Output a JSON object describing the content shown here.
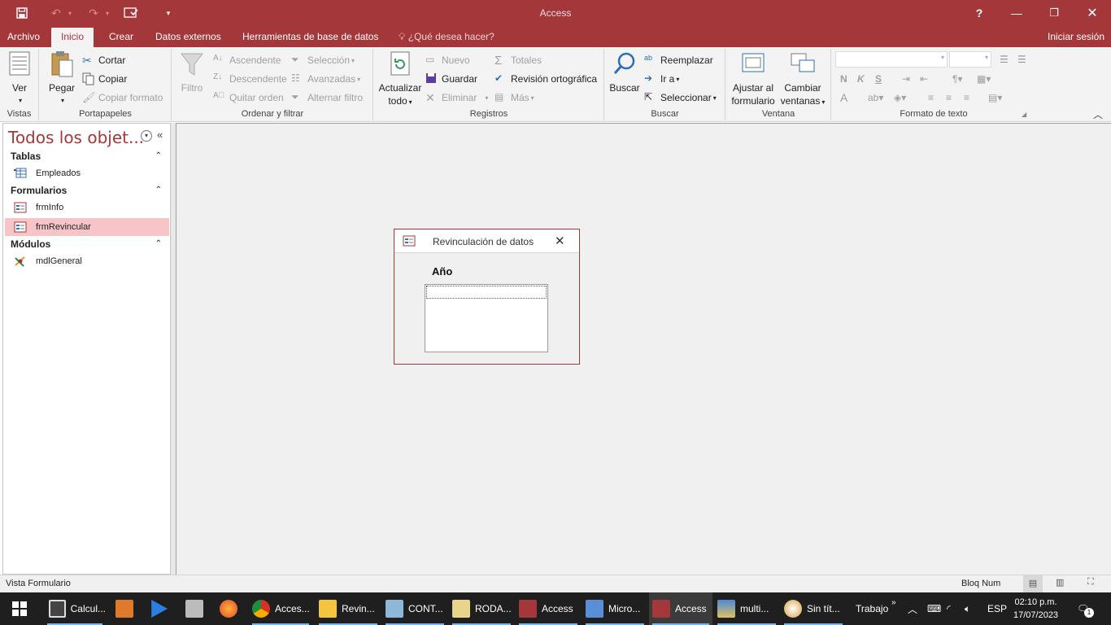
{
  "app": {
    "title": "Access",
    "help": "?",
    "signin": "Iniciar sesión"
  },
  "qat": {
    "save": "save-icon",
    "undo": "undo-icon",
    "redo": "redo-icon",
    "custom": "form-view-icon",
    "more": "▾"
  },
  "window": {
    "minimize": "—",
    "restore": "❐",
    "close": "✕"
  },
  "tabs": [
    {
      "label": "Archivo"
    },
    {
      "label": "Inicio"
    },
    {
      "label": "Crear"
    },
    {
      "label": "Datos externos"
    },
    {
      "label": "Herramientas de base de datos"
    }
  ],
  "tellme": "¿Qué desea hacer?",
  "ribbon": {
    "vistas": {
      "label": "Vistas",
      "ver": "Ver"
    },
    "portapapeles": {
      "label": "Portapapeles",
      "pegar": "Pegar",
      "cortar": "Cortar",
      "copiar": "Copiar",
      "copiar_formato": "Copiar formato"
    },
    "ordenar": {
      "label": "Ordenar y filtrar",
      "filtro": "Filtro",
      "ascendente": "Ascendente",
      "descendente": "Descendente",
      "quitar_orden": "Quitar orden",
      "seleccion": "Selección",
      "avanzadas": "Avanzadas",
      "alternar_filtro": "Alternar filtro"
    },
    "registros": {
      "label": "Registros",
      "actualizar": "Actualizar",
      "todo": "todo",
      "nuevo": "Nuevo",
      "guardar": "Guardar",
      "eliminar": "Eliminar",
      "totales": "Totales",
      "revision": "Revisión ortográfica",
      "mas": "Más"
    },
    "buscar": {
      "label": "Buscar",
      "buscar": "Buscar",
      "reemplazar": "Reemplazar",
      "ir_a": "Ir a",
      "seleccionar": "Seleccionar"
    },
    "ventana": {
      "label": "Ventana",
      "ajustar1": "Ajustar al",
      "ajustar2": "formulario",
      "cambiar1": "Cambiar",
      "cambiar2": "ventanas"
    },
    "formato": {
      "label": "Formato de texto",
      "bold": "N",
      "italic": "K",
      "underline": "S",
      "font_color": "A"
    }
  },
  "nav": {
    "title": "Todos los objet...",
    "sections": [
      {
        "label": "Tablas",
        "items": [
          {
            "label": "Empleados"
          }
        ]
      },
      {
        "label": "Formularios",
        "items": [
          {
            "label": "frmInfo"
          },
          {
            "label": "frmRevincular"
          }
        ]
      },
      {
        "label": "Módulos",
        "items": [
          {
            "label": "mdlGeneral"
          }
        ]
      }
    ]
  },
  "dialog": {
    "title": "Revinculación de datos",
    "field_label": "Año",
    "field_value": ""
  },
  "status": {
    "left": "Vista Formulario",
    "right": "Bloq Num"
  },
  "taskbar": {
    "items": [
      {
        "label": "Calcul..."
      },
      {
        "label": ""
      },
      {
        "label": ""
      },
      {
        "label": ""
      },
      {
        "label": ""
      },
      {
        "label": "Acces..."
      },
      {
        "label": "Revin..."
      },
      {
        "label": "CONT..."
      },
      {
        "label": "RODA..."
      },
      {
        "label": "Access"
      },
      {
        "label": "Micro..."
      },
      {
        "label": "Access"
      },
      {
        "label": "multi..."
      },
      {
        "label": "Sin tít..."
      }
    ],
    "trabajo": "Trabajo",
    "lang": "ESP",
    "time": "02:10 p.m.",
    "date": "17/07/2023",
    "notif": "1"
  }
}
